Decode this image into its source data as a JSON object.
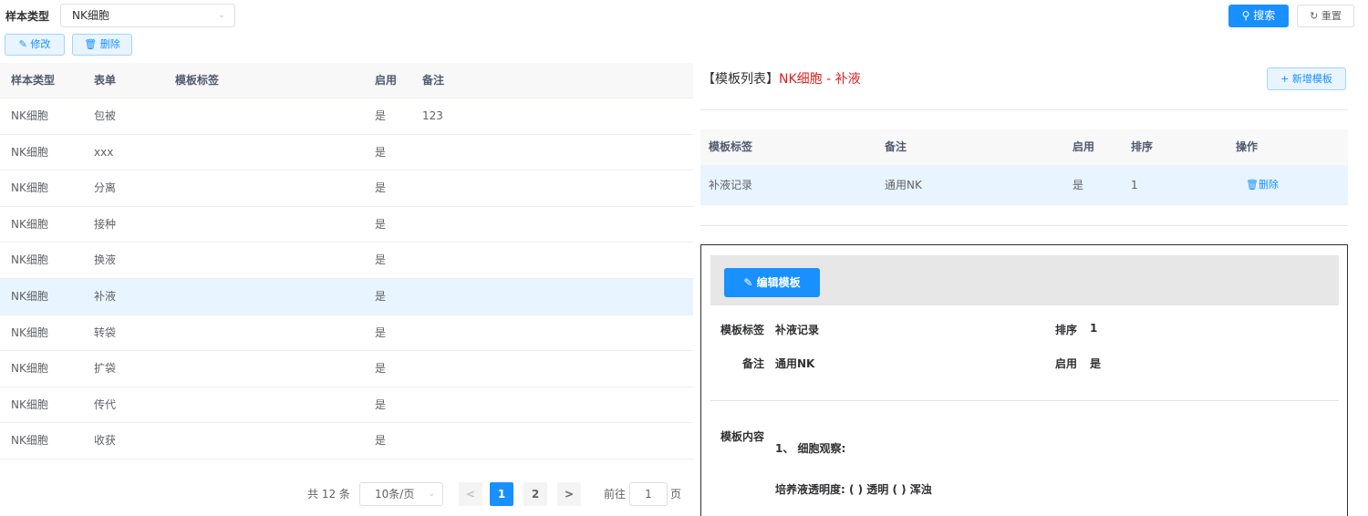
{
  "filter": {
    "label": "样本类型",
    "sample_type_value": "NK细胞",
    "search_label": "搜索",
    "reset_label": "重置"
  },
  "actions": {
    "edit_label": "修改",
    "delete_label": "删除"
  },
  "left_table": {
    "columns": [
      "样本类型",
      "表单",
      "模板标签",
      "启用",
      "备注"
    ],
    "rows": [
      {
        "sample_type": "NK细胞",
        "form": "包被",
        "tag": "",
        "enabled": "是",
        "remark": "123"
      },
      {
        "sample_type": "NK细胞",
        "form": "xxx",
        "tag": "",
        "enabled": "是",
        "remark": ""
      },
      {
        "sample_type": "NK细胞",
        "form": "分离",
        "tag": "",
        "enabled": "是",
        "remark": ""
      },
      {
        "sample_type": "NK细胞",
        "form": "接种",
        "tag": "",
        "enabled": "是",
        "remark": ""
      },
      {
        "sample_type": "NK细胞",
        "form": "换液",
        "tag": "",
        "enabled": "是",
        "remark": ""
      },
      {
        "sample_type": "NK细胞",
        "form": "补液",
        "tag": "",
        "enabled": "是",
        "remark": ""
      },
      {
        "sample_type": "NK细胞",
        "form": "转袋",
        "tag": "",
        "enabled": "是",
        "remark": ""
      },
      {
        "sample_type": "NK细胞",
        "form": "扩袋",
        "tag": "",
        "enabled": "是",
        "remark": ""
      },
      {
        "sample_type": "NK细胞",
        "form": "传代",
        "tag": "",
        "enabled": "是",
        "remark": ""
      },
      {
        "sample_type": "NK细胞",
        "form": "收获",
        "tag": "",
        "enabled": "是",
        "remark": ""
      }
    ],
    "selected_row": 5
  },
  "pagination": {
    "total": "共 12 条",
    "page_size": "10条/页",
    "prev": "<",
    "pages": [
      "1",
      "2"
    ],
    "current_page": "1",
    "next": ">",
    "goto_label": "前往",
    "goto_value": "1",
    "page_suffix": "页"
  },
  "template_list": {
    "title_prefix": "【模板列表】",
    "title_highlight": "NK细胞 - 补液",
    "new_button_label": "新增模板",
    "columns": [
      "模板标签",
      "备注",
      "启用",
      "排序",
      "操作"
    ],
    "rows": [
      {
        "tag": "补液记录",
        "remark": "通用NK",
        "enabled": "是",
        "order": "1",
        "action": "删除"
      }
    ]
  },
  "template_detail": {
    "edit_button_label": "编辑模板",
    "tag_label": "模板标签",
    "tag_value": "补液记录",
    "order_label": "排序",
    "order_value": "1",
    "remark_label": "备注",
    "remark_value": "通用NK",
    "enabled_label": "启用",
    "enabled_value": "是",
    "content_label": "模板内容",
    "content_heading": "1、 细胞观察:",
    "content_line": "培养液透明度: ( ) 透明 ( ) 浑浊"
  },
  "colors": {
    "primary": "#1890ff",
    "highlight_red": "#e02020",
    "selected_row_bg": "#e8f4ff"
  },
  "icons": [
    "search-icon",
    "refresh-icon",
    "edit-icon",
    "delete-icon",
    "plus-icon",
    "chevron-down-icon"
  ]
}
